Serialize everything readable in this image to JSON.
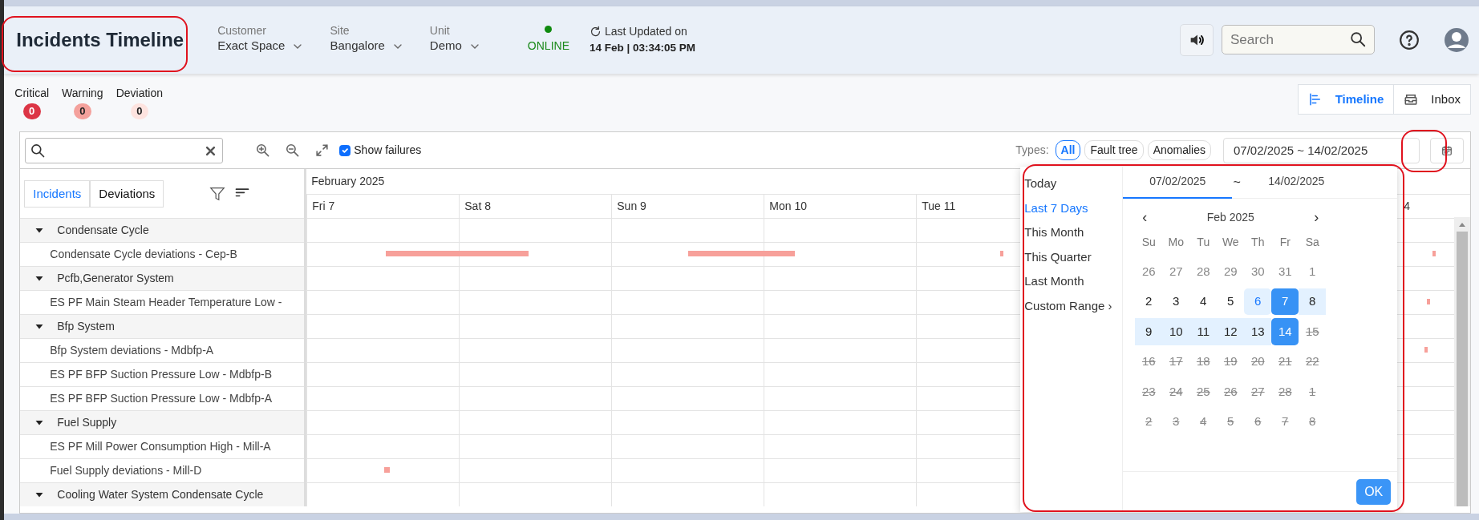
{
  "header": {
    "title": "Incidents Timeline",
    "filters": [
      {
        "label": "Customer",
        "value": "Exact Space"
      },
      {
        "label": "Site",
        "value": "Bangalore"
      },
      {
        "label": "Unit",
        "value": "Demo"
      }
    ],
    "status": {
      "text": "ONLINE",
      "online": true
    },
    "last_updated": {
      "label": "Last Updated on",
      "value": "14 Feb | 03:34:05 PM"
    },
    "search": {
      "placeholder": "Search"
    }
  },
  "counters": [
    {
      "label": "Critical",
      "count": "0",
      "color": "#dc3545"
    },
    {
      "label": "Warning",
      "count": "0",
      "color": "#f4a19c"
    },
    {
      "label": "Deviation",
      "count": "0",
      "color": "#fde3df"
    }
  ],
  "view_tabs": [
    {
      "label": "Timeline",
      "selected": true
    },
    {
      "label": "Inbox",
      "selected": false
    }
  ],
  "toolbar": {
    "show_failures": {
      "label": "Show failures",
      "checked": true
    },
    "types_label": "Types:",
    "types": [
      {
        "label": "All",
        "selected": true
      },
      {
        "label": "Fault tree",
        "selected": false
      },
      {
        "label": "Anomalies",
        "selected": false
      }
    ],
    "date_range": "07/02/2025 ~ 14/02/2025"
  },
  "list_tabs": [
    {
      "label": "Incidents",
      "selected": true
    },
    {
      "label": "Deviations",
      "selected": false
    }
  ],
  "rows": [
    {
      "kind": "group",
      "label": "Condensate Cycle",
      "expanded": true
    },
    {
      "kind": "item",
      "label": "Condensate Cycle deviations - Cep-B"
    },
    {
      "kind": "group",
      "label": "Pcfb,Generator System",
      "expanded": true
    },
    {
      "kind": "item",
      "label": "ES PF Main Steam Header Temperature Low -"
    },
    {
      "kind": "group",
      "label": "Bfp System",
      "expanded": true
    },
    {
      "kind": "item",
      "label": "Bfp System deviations - Mdbfp-A"
    },
    {
      "kind": "item",
      "label": "ES PF BFP Suction Pressure Low - Mdbfp-B"
    },
    {
      "kind": "item",
      "label": "ES PF BFP Suction Pressure Low - Mdbfp-A"
    },
    {
      "kind": "group",
      "label": "Fuel Supply",
      "expanded": true
    },
    {
      "kind": "item",
      "label": "ES PF Mill Power Consumption High - Mill-A"
    },
    {
      "kind": "item",
      "label": "Fuel Supply deviations - Mill-D"
    },
    {
      "kind": "group",
      "label": "Cooling Water System Condensate Cycle",
      "expanded": true
    }
  ],
  "timeline": {
    "month": "February 2025",
    "days": [
      "Fri 7",
      "Sat 8",
      "Sun 9",
      "Mon 10",
      "Tue 11"
    ],
    "day_cut": "4"
  },
  "date_picker": {
    "presets": [
      {
        "label": "Today",
        "selected": false
      },
      {
        "label": "Last 7 Days",
        "selected": true
      },
      {
        "label": "This Month",
        "selected": false
      },
      {
        "label": "This Quarter",
        "selected": false
      },
      {
        "label": "Last Month",
        "selected": false
      },
      {
        "label": "Custom Range ›",
        "selected": false
      }
    ],
    "start": {
      "text": "07/02/2025",
      "selected": true
    },
    "separator": "~",
    "end": {
      "text": "14/02/2025",
      "selected": false
    },
    "month": "Feb 2025",
    "prev": "‹",
    "next": "›",
    "weekdays": [
      "Su",
      "Mo",
      "Tu",
      "We",
      "Th",
      "Fr",
      "Sa"
    ],
    "weeks": [
      [
        {
          "day": "26",
          "kind": "muted"
        },
        {
          "day": "27",
          "kind": "muted"
        },
        {
          "day": "28",
          "kind": "muted"
        },
        {
          "day": "29",
          "kind": "muted"
        },
        {
          "day": "30",
          "kind": "muted"
        },
        {
          "day": "31",
          "kind": "muted"
        },
        {
          "day": "1",
          "kind": "muted"
        }
      ],
      [
        {
          "day": "2",
          "kind": "normal"
        },
        {
          "day": "3",
          "kind": "normal"
        },
        {
          "day": "4",
          "kind": "normal"
        },
        {
          "day": "5",
          "kind": "normal"
        },
        {
          "day": "6",
          "kind": "hover"
        },
        {
          "day": "7",
          "kind": "selected"
        },
        {
          "day": "8",
          "kind": "range"
        }
      ],
      [
        {
          "day": "9",
          "kind": "range"
        },
        {
          "day": "10",
          "kind": "range"
        },
        {
          "day": "11",
          "kind": "range"
        },
        {
          "day": "12",
          "kind": "range"
        },
        {
          "day": "13",
          "kind": "range"
        },
        {
          "day": "14",
          "kind": "selected"
        },
        {
          "day": "15",
          "kind": "disabled"
        }
      ],
      [
        {
          "day": "16",
          "kind": "disabled"
        },
        {
          "day": "17",
          "kind": "disabled"
        },
        {
          "day": "18",
          "kind": "disabled"
        },
        {
          "day": "19",
          "kind": "disabled"
        },
        {
          "day": "20",
          "kind": "disabled"
        },
        {
          "day": "21",
          "kind": "disabled"
        },
        {
          "day": "22",
          "kind": "disabled"
        }
      ],
      [
        {
          "day": "23",
          "kind": "disabled"
        },
        {
          "day": "24",
          "kind": "disabled"
        },
        {
          "day": "25",
          "kind": "disabled"
        },
        {
          "day": "26",
          "kind": "disabled"
        },
        {
          "day": "27",
          "kind": "disabled"
        },
        {
          "day": "28",
          "kind": "disabled"
        },
        {
          "day": "1",
          "kind": "disabled"
        }
      ],
      [
        {
          "day": "2",
          "kind": "disabled"
        },
        {
          "day": "3",
          "kind": "disabled"
        },
        {
          "day": "4",
          "kind": "disabled"
        },
        {
          "day": "5",
          "kind": "disabled"
        },
        {
          "day": "6",
          "kind": "disabled"
        },
        {
          "day": "7",
          "kind": "disabled"
        },
        {
          "day": "8",
          "kind": "disabled"
        }
      ]
    ],
    "ok": "OK"
  }
}
